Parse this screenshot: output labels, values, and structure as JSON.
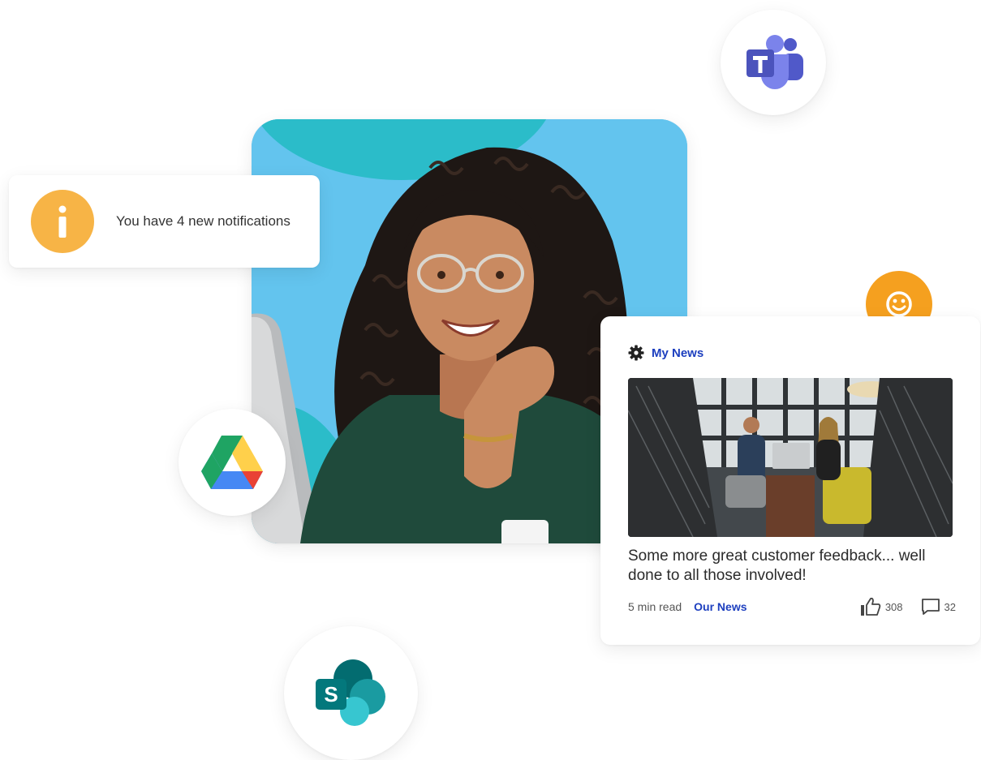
{
  "notification": {
    "icon": "info-icon",
    "text": "You have 4 new notifications",
    "color": "#f7b446"
  },
  "news": {
    "section_icon": "gear-icon",
    "section_title": "My News",
    "headline": "Some more great customer feedback... well done to all those involved!",
    "read_time": "5 min read",
    "category": "Our News",
    "likes": "308",
    "comments": "32",
    "accent": "#1d3fbf"
  },
  "apps": [
    {
      "name": "teams-icon",
      "color": "#5059c9"
    },
    {
      "name": "google-drive-icon",
      "color": "#1fa463"
    },
    {
      "name": "sharepoint-icon",
      "color": "#03787c"
    }
  ],
  "badge": {
    "icon": "smiley-icon",
    "color": "#f5a01f"
  },
  "colors": {
    "photo_background": "#63c4ee",
    "photo_shape": "#2bbcc9"
  }
}
